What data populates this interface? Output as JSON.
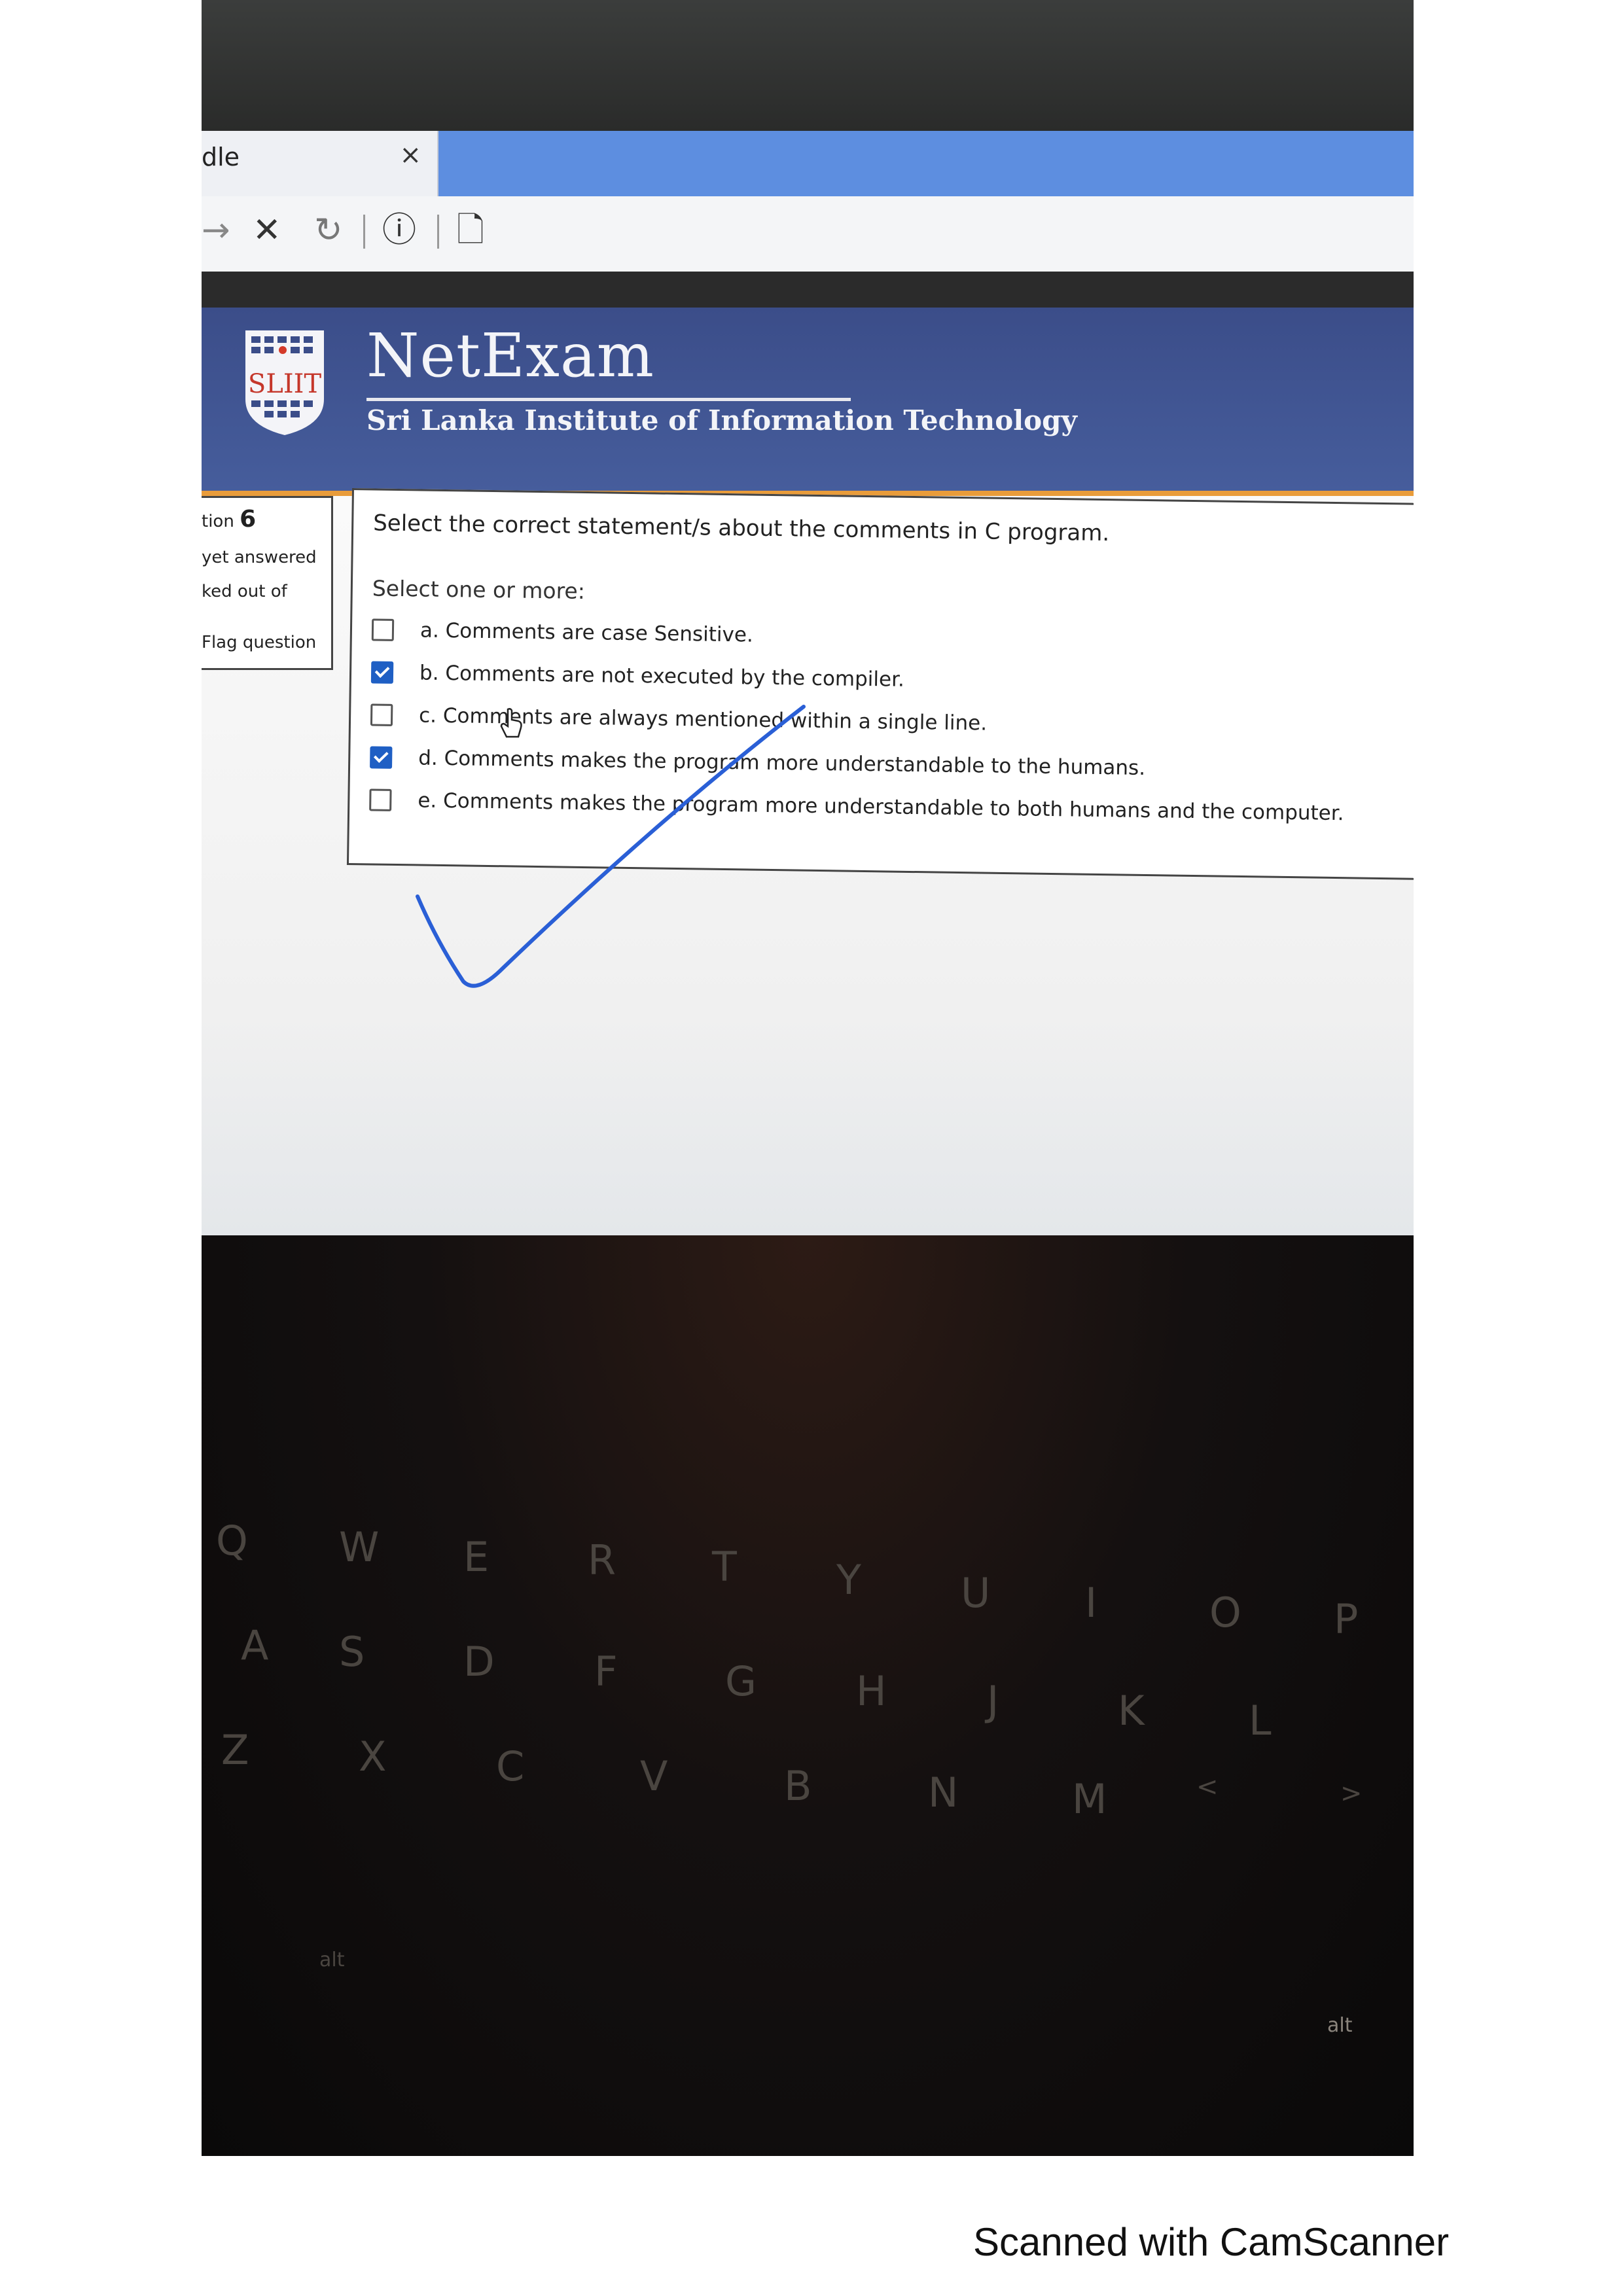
{
  "browser": {
    "tab_title": "dle",
    "tab_close": "×",
    "nav": {
      "back": "→",
      "stop": "✕",
      "reload": "↻",
      "info": "ⓘ",
      "page": "🗋"
    }
  },
  "header": {
    "brand_name": "NetExam",
    "brand_subtitle": "Sri Lanka Institute of Information Technology",
    "logo_text": "SLIIT",
    "colors": {
      "header_bg": "#465d9c",
      "accent": "#e99c3a",
      "checkbox_checked": "#1f5fc4",
      "tick": "#2a5fd6"
    }
  },
  "question_info": {
    "label": "tion",
    "number": "6",
    "status": "yet answered",
    "marks": "ked out of",
    "flag": "Flag question"
  },
  "question": {
    "text": "Select the correct statement/s about the comments in C program.",
    "prompt": "Select one or more:",
    "options": [
      {
        "label": "a. Comments are case Sensitive.",
        "checked": false
      },
      {
        "label": "b. Comments are not executed by the compiler.",
        "checked": true
      },
      {
        "label": "c. Comments are always mentioned within a single line.",
        "checked": false
      },
      {
        "label": "d. Comments makes the program more understandable to the humans.",
        "checked": true
      },
      {
        "label": "e. Comments makes the program more understandable to both humans and the computer.",
        "checked": false
      }
    ]
  },
  "keyboard": {
    "keys": [
      "Q",
      "W",
      "E",
      "R",
      "T",
      "Y",
      "U",
      "I",
      "O",
      "P",
      "A",
      "S",
      "D",
      "F",
      "G",
      "H",
      "J",
      "K",
      "L",
      "Z",
      "X",
      "C",
      "V",
      "B",
      "N",
      "M",
      "<",
      ">",
      "alt",
      "alt"
    ]
  },
  "footer": {
    "watermark": "Scanned with CamScanner"
  }
}
